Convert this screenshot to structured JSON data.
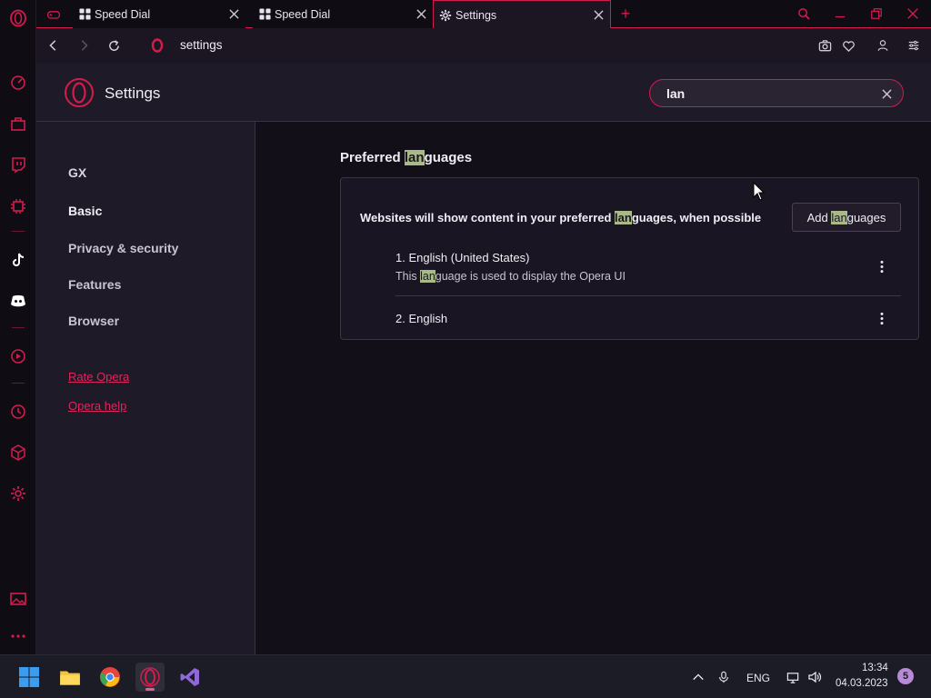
{
  "tabs": [
    {
      "title": "Speed Dial",
      "active": false
    },
    {
      "title": "Speed Dial",
      "active": false
    },
    {
      "title": "Settings",
      "active": true
    }
  ],
  "address": {
    "url": "settings"
  },
  "header": {
    "title": "Settings",
    "search_value": "lan"
  },
  "nav": {
    "items": [
      "GX",
      "Basic",
      "Privacy & security",
      "Features",
      "Browser"
    ],
    "links": [
      "Rate Opera",
      "Opera help"
    ]
  },
  "languages": {
    "section_title_pre": "Preferred ",
    "section_title_hl": "lan",
    "section_title_post": "guages",
    "desc_pre": "Websites will show content in your preferred ",
    "desc_hl": "lan",
    "desc_post": "guages, when possible",
    "add_pre": "Add ",
    "add_hl": "lan",
    "add_post": "guages",
    "items": [
      {
        "name": "1. English (United States)",
        "sub_pre": "This ",
        "sub_hl": "lan",
        "sub_post": "guage is used to display the Opera UI"
      },
      {
        "name": "2. English"
      }
    ]
  },
  "taskbar": {
    "lang": "ENG",
    "time": "13:34",
    "date": "04.03.2023",
    "notifications": "5"
  },
  "colors": {
    "accent": "#d41b4d",
    "highlight": "#a9b98a"
  }
}
